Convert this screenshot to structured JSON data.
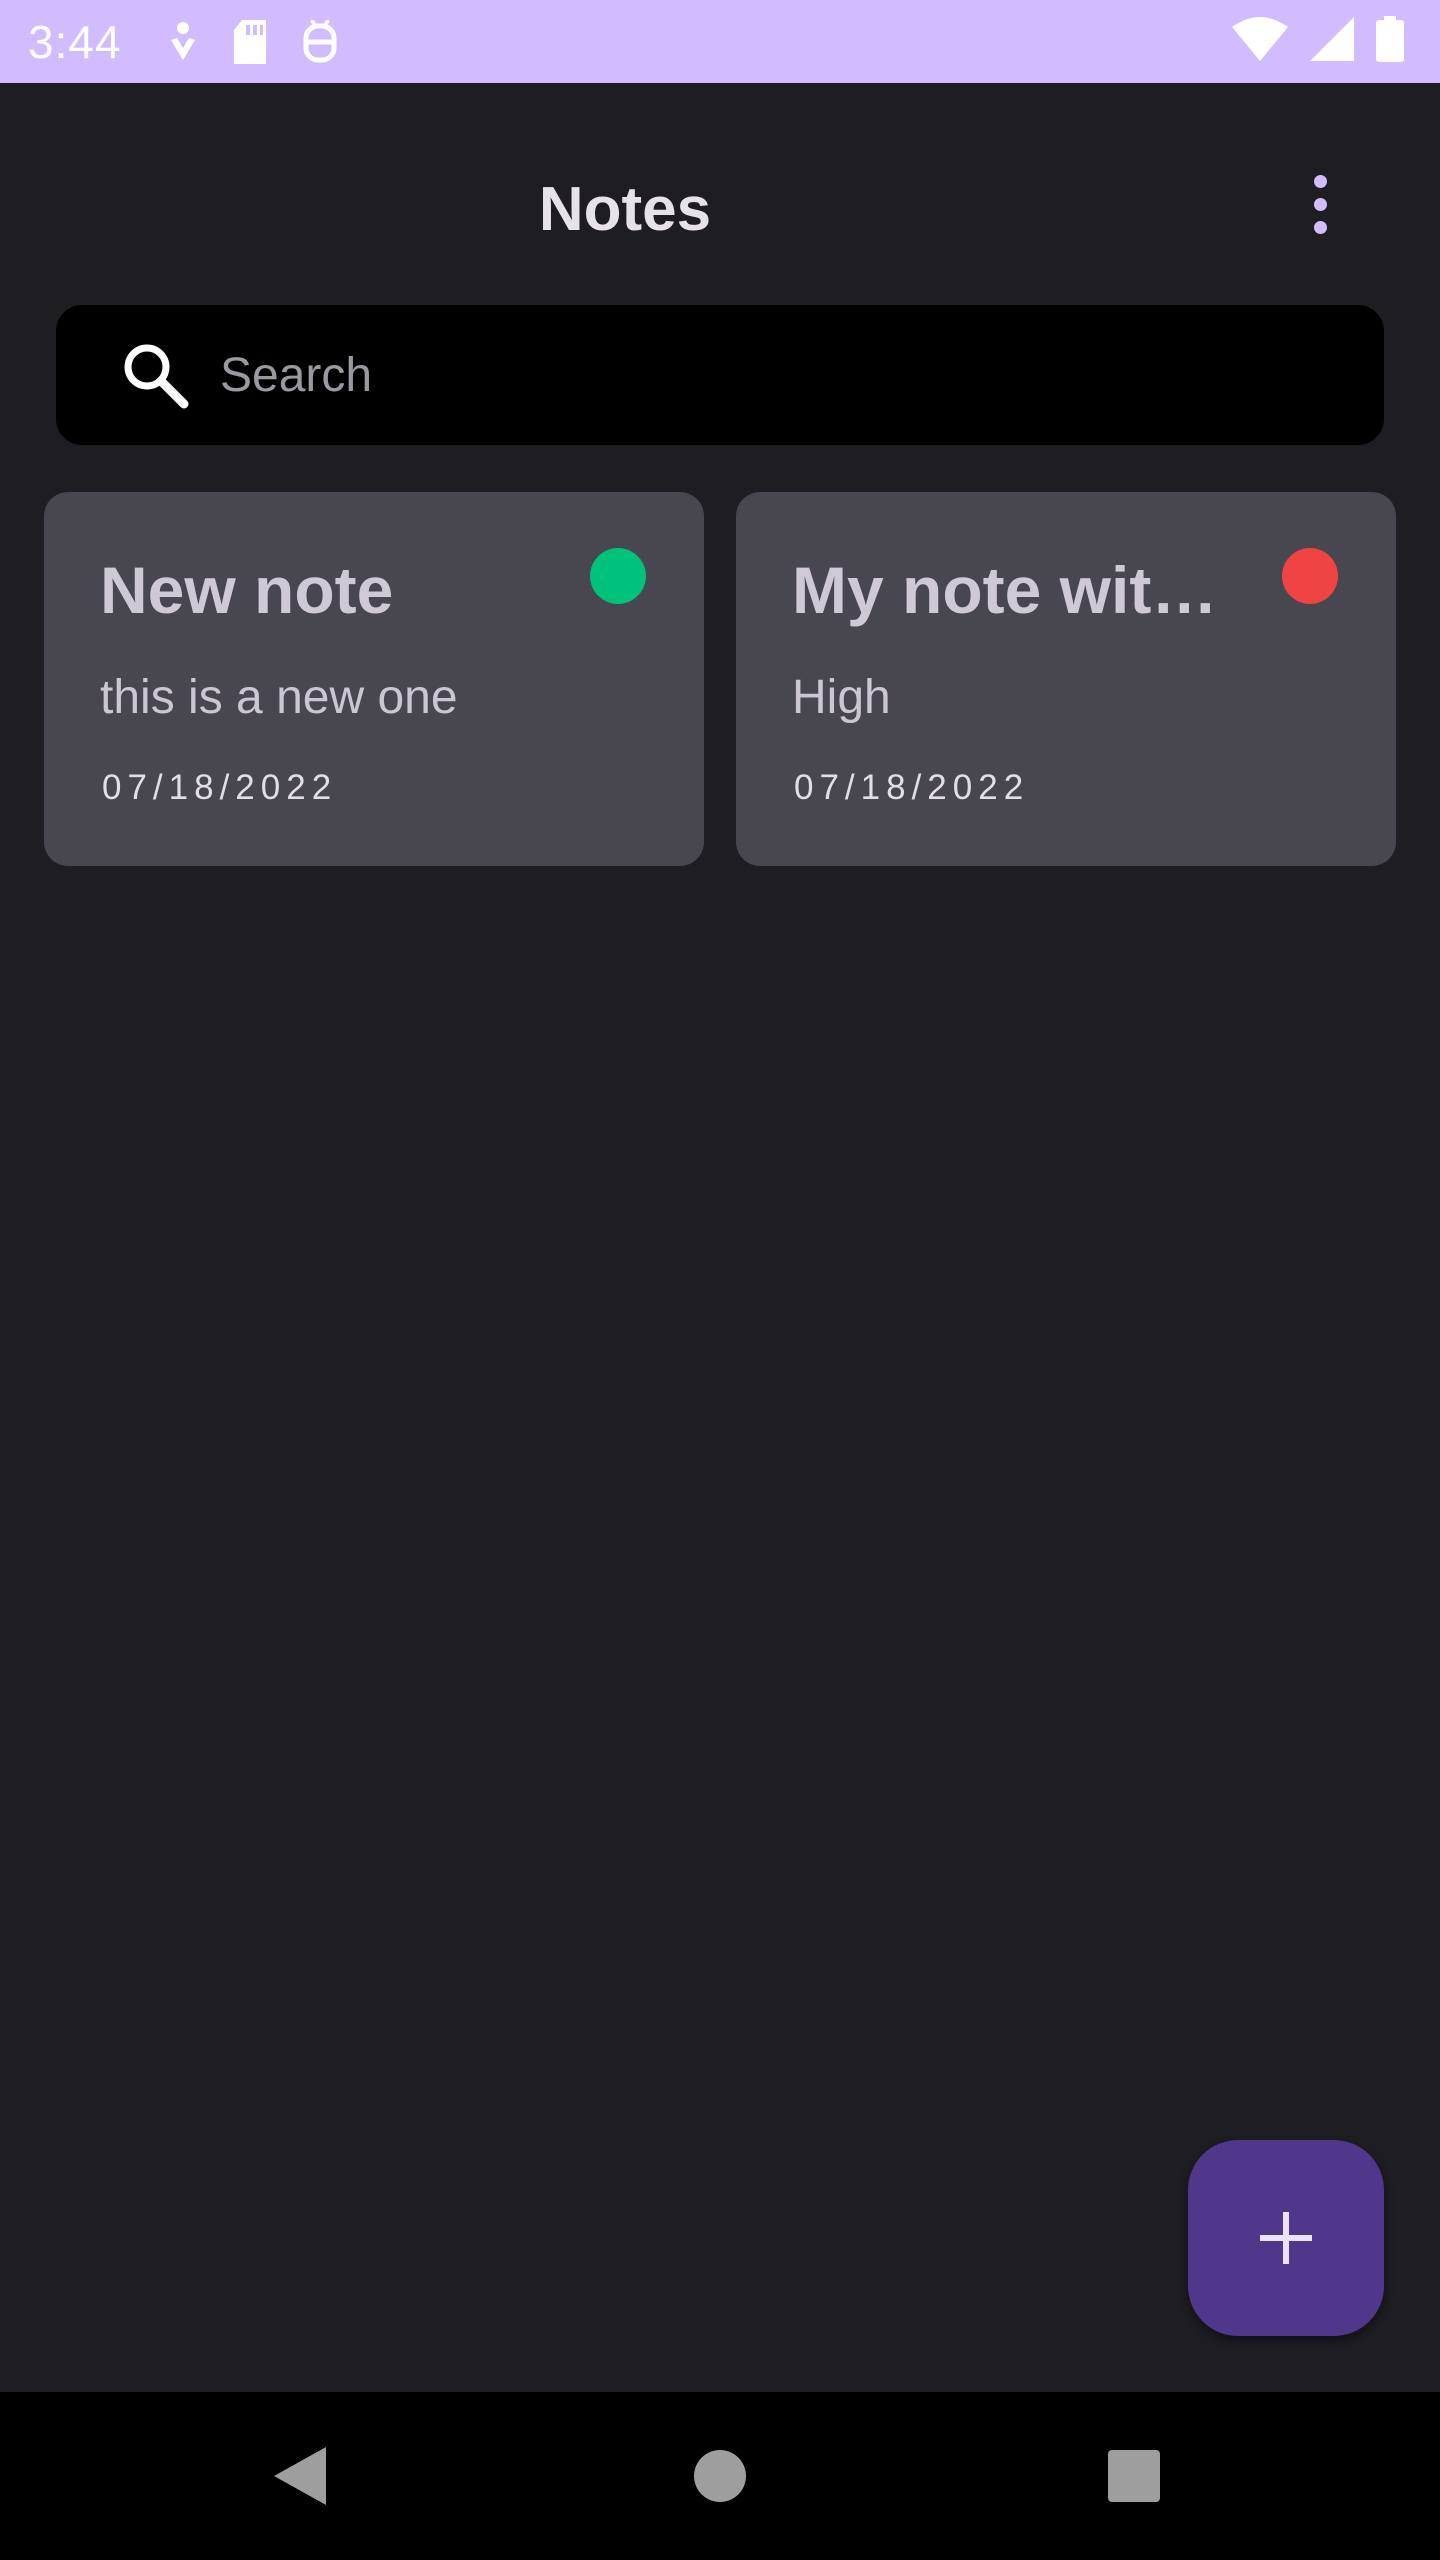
{
  "status_bar": {
    "time": "3:44"
  },
  "header": {
    "title": "Notes"
  },
  "search": {
    "placeholder": "Search",
    "value": ""
  },
  "notes": [
    {
      "title": "New note",
      "body": "this is a new one",
      "date": "07/18/2022",
      "priority_color": "#00c27a"
    },
    {
      "title": "My note wit…",
      "body": "High",
      "date": "07/18/2022",
      "priority_color": "#f04444"
    }
  ],
  "colors": {
    "accent": "#d0bcff",
    "fab": "#4f378b",
    "card": "#48464f",
    "background": "#1e1d22"
  }
}
